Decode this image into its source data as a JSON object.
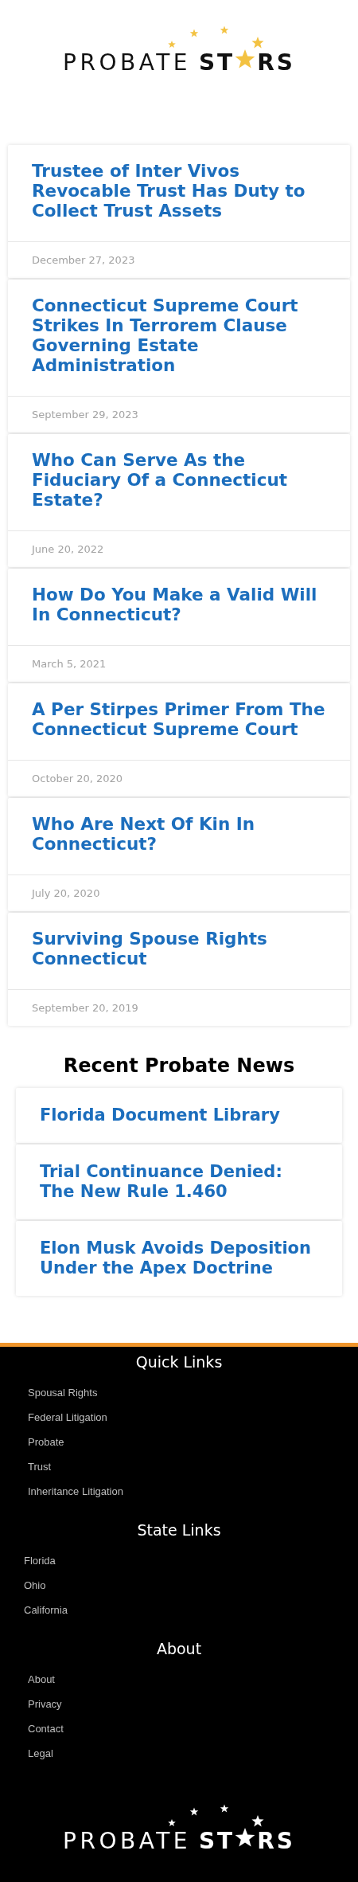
{
  "header": {
    "logo": {
      "word": "PROBATE",
      "mark_start": "ST",
      "mark_end": "RS"
    }
  },
  "posts": [
    {
      "title": "Trustee of Inter Vivos Revocable Trust Has Duty to Collect Trust Assets",
      "date": "December 27, 2023"
    },
    {
      "title": "Connecticut Supreme Court Strikes In Terrorem Clause Governing Estate Administration",
      "date": "September 29, 2023"
    },
    {
      "title": "Who Can Serve As the Fiduciary Of a Connecticut Estate?",
      "date": "June 20, 2022"
    },
    {
      "title": "How Do You Make a Valid Will In Connecticut?",
      "date": "March 5, 2021"
    },
    {
      "title": "A Per Stirpes Primer From The Connecticut Supreme Court",
      "date": "October 20, 2020"
    },
    {
      "title": "Who Are Next Of Kin In Connecticut?",
      "date": "July 20, 2020"
    },
    {
      "title": "Surviving Spouse Rights Connecticut",
      "date": "September 20, 2019"
    }
  ],
  "news": {
    "heading": "Recent Probate News",
    "items": [
      {
        "title": "Florida Document Library"
      },
      {
        "title": "Trial Continuance Denied: The New Rule 1.460"
      },
      {
        "title": "Elon Musk Avoids Deposition Under the Apex Doctrine"
      }
    ]
  },
  "footer": {
    "sections": [
      {
        "heading": "Quick Links",
        "kind": "indented",
        "links": [
          "Spousal Rights",
          "Federal Litigation",
          "Probate",
          "Trust",
          "Inheritance Litigation"
        ]
      },
      {
        "heading": "State Links",
        "kind": "flush",
        "links": [
          "Florida",
          "Ohio",
          "California"
        ]
      },
      {
        "heading": "About",
        "kind": "indented",
        "links": [
          "About",
          "Privacy",
          "Contact",
          "Legal"
        ]
      }
    ],
    "logo": {
      "word": "PROBATE",
      "mark_start": "ST",
      "mark_end": "RS"
    }
  }
}
